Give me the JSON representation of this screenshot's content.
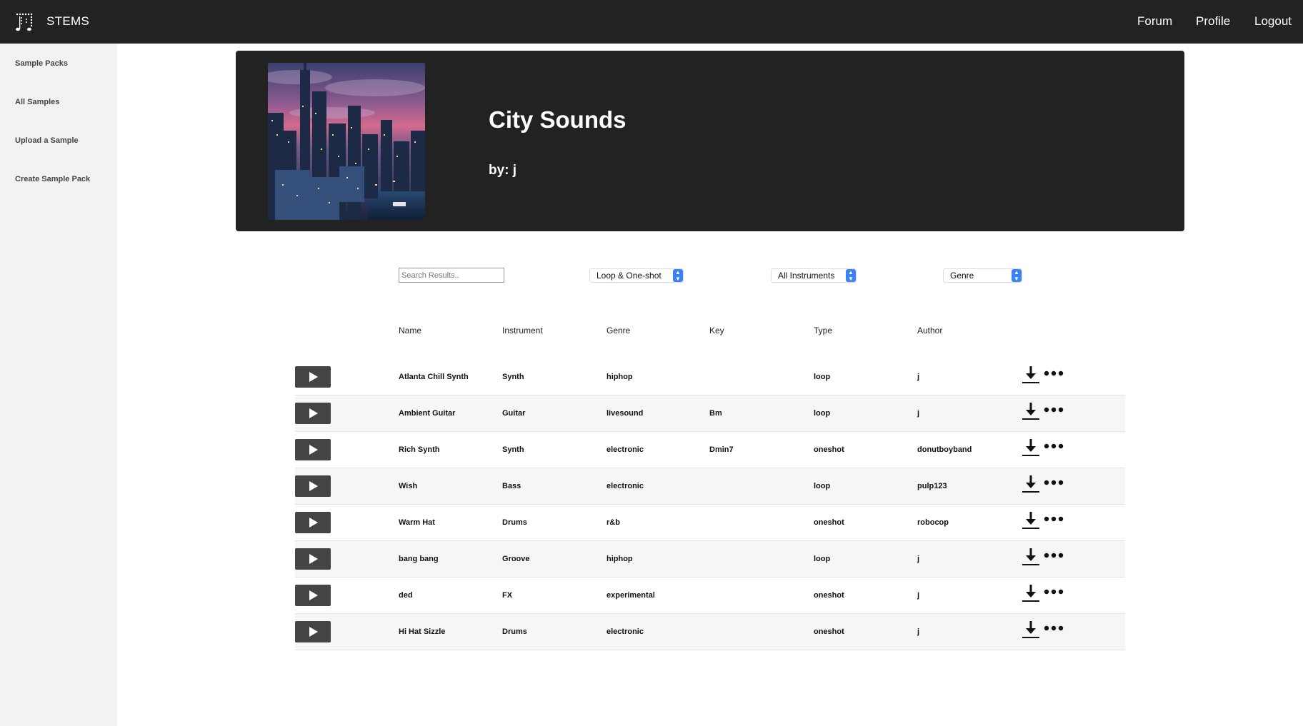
{
  "app": {
    "brand": "STEMS",
    "nav": [
      "Forum",
      "Profile",
      "Logout"
    ],
    "logo_icon": "music-dots-logo"
  },
  "sidebar": {
    "items": [
      {
        "label": "Sample Packs"
      },
      {
        "label": "All Samples"
      },
      {
        "label": "Upload a Sample"
      },
      {
        "label": "Create Sample Pack"
      }
    ]
  },
  "pack": {
    "title": "City Sounds",
    "author_line": "by: j",
    "cover_icon": "city-skyline-image"
  },
  "filters": {
    "search_placeholder": "Search Results..",
    "type_select": "Loop & One-shot",
    "instrument_select": "All Instruments",
    "genre_select": "Genre"
  },
  "table": {
    "columns": [
      "Name",
      "Instrument",
      "Genre",
      "Key",
      "Type",
      "Author"
    ],
    "rows": [
      {
        "name": "Atlanta Chill Synth",
        "instrument": "Synth",
        "genre": "hiphop",
        "key": "",
        "type": "loop",
        "author": "j"
      },
      {
        "name": "Ambient Guitar",
        "instrument": "Guitar",
        "genre": "livesound",
        "key": "Bm",
        "type": "loop",
        "author": "j"
      },
      {
        "name": "Rich Synth",
        "instrument": "Synth",
        "genre": "electronic",
        "key": "Dmin7",
        "type": "oneshot",
        "author": "donutboyband"
      },
      {
        "name": "Wish",
        "instrument": "Bass",
        "genre": "electronic",
        "key": "",
        "type": "loop",
        "author": "pulp123"
      },
      {
        "name": "Warm Hat",
        "instrument": "Drums",
        "genre": "r&b",
        "key": "",
        "type": "oneshot",
        "author": "robocop"
      },
      {
        "name": "bang bang",
        "instrument": "Groove",
        "genre": "hiphop",
        "key": "",
        "type": "loop",
        "author": "j"
      },
      {
        "name": "ded",
        "instrument": "FX",
        "genre": "experimental",
        "key": "",
        "type": "oneshot",
        "author": "j"
      },
      {
        "name": "Hi Hat Sizzle",
        "instrument": "Drums",
        "genre": "electronic",
        "key": "",
        "type": "oneshot",
        "author": "j"
      }
    ]
  },
  "colors": {
    "topbar": "#222222",
    "hero": "#222222",
    "sidebar": "#f2f2f2",
    "play_button": "#444444",
    "select_arrow": "#3b82f6"
  }
}
